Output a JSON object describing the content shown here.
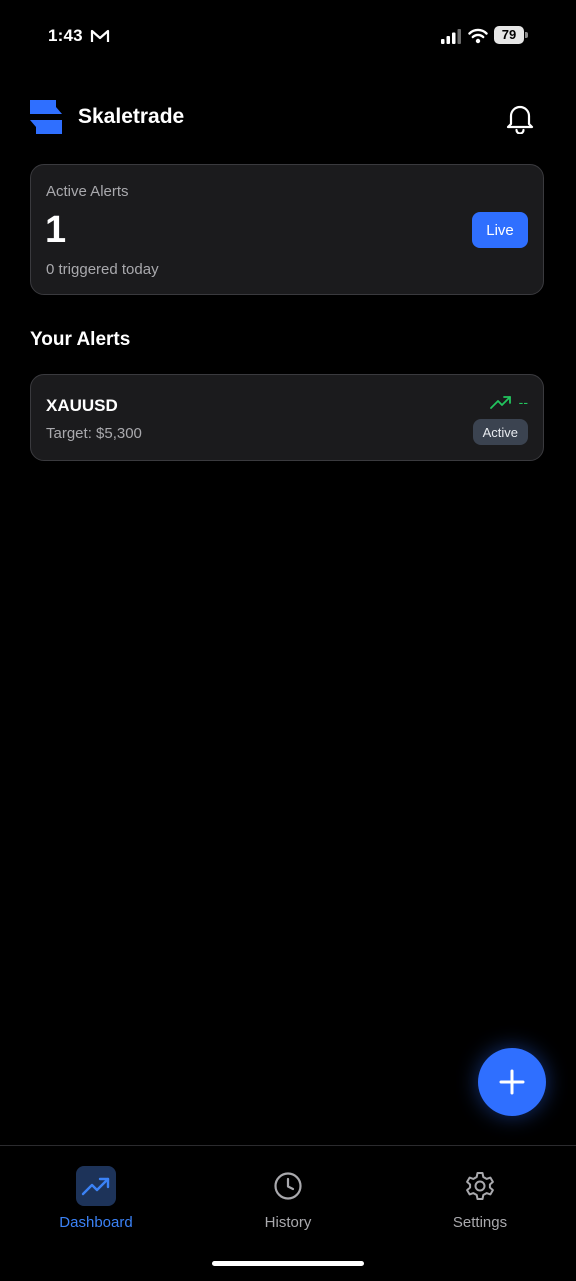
{
  "status_bar": {
    "time": "1:43",
    "battery": "79"
  },
  "header": {
    "brand": "Skaletrade"
  },
  "summary": {
    "label": "Active Alerts",
    "count": "1",
    "subtext": "0 triggered today",
    "badge": "Live"
  },
  "section": {
    "title": "Your Alerts"
  },
  "alerts": [
    {
      "symbol": "XAUUSD",
      "target": "Target: $5,300",
      "change": "--",
      "status": "Active"
    }
  ],
  "nav": [
    {
      "label": "Dashboard",
      "icon": "trending-up-icon",
      "active": true
    },
    {
      "label": "History",
      "icon": "clock-icon",
      "active": false
    },
    {
      "label": "Settings",
      "icon": "gear-icon",
      "active": false
    }
  ],
  "colors": {
    "accent": "#2f6fff",
    "positive": "#22c55e",
    "card_bg": "#1b1b1d"
  }
}
